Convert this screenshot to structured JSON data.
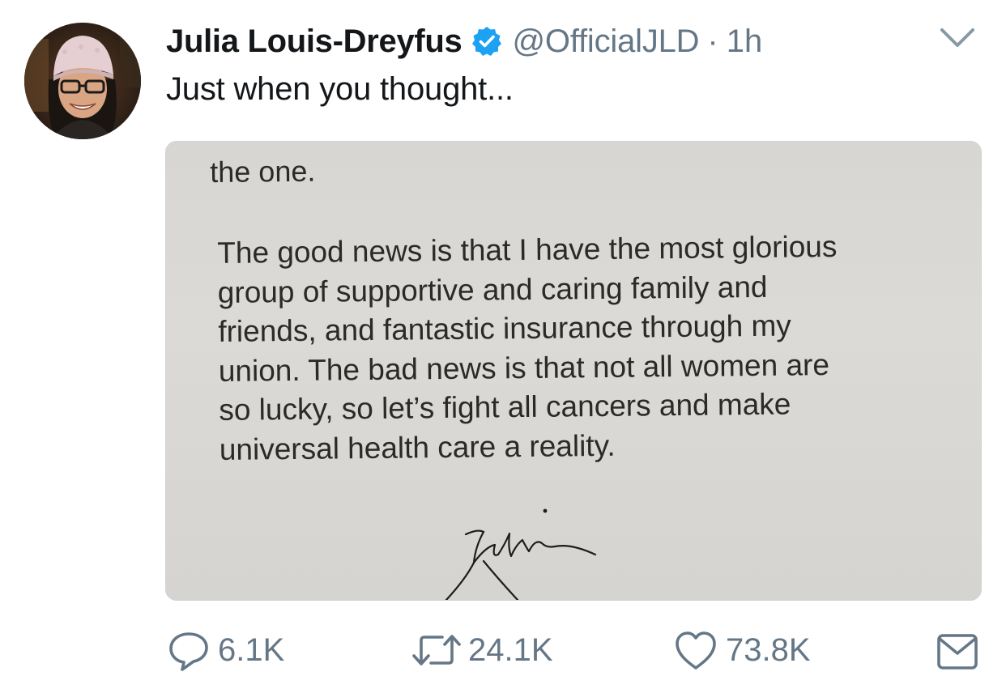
{
  "tweet": {
    "display_name": "Julia Louis-Dreyfus",
    "handle": "@OfficialJLD",
    "separator": "·",
    "time": "1h",
    "text": "Just when you thought...",
    "verified": true,
    "avatar_icon": "profile-photo",
    "menu_icon": "chevron-down-icon"
  },
  "media": {
    "letter_line_top": "the one.",
    "letter_paragraph": "The good news is that I have the most glorious\ngroup of supportive and caring family and\nfriends, and fantastic insurance through my\nunion. The bad news is that not all women are\nso lucky, so let’s fight all cancers and make\nuniversal health care a reality.",
    "signature": "Julia"
  },
  "actions": {
    "reply_count": "6.1K",
    "retweet_count": "24.1K",
    "like_count": "73.8K",
    "reply_icon": "reply-icon",
    "retweet_icon": "retweet-icon",
    "like_icon": "heart-icon",
    "dm_icon": "envelope-icon"
  },
  "colors": {
    "verified_blue": "#1da1f2",
    "secondary_text": "#657786",
    "primary_text": "#14171a"
  }
}
